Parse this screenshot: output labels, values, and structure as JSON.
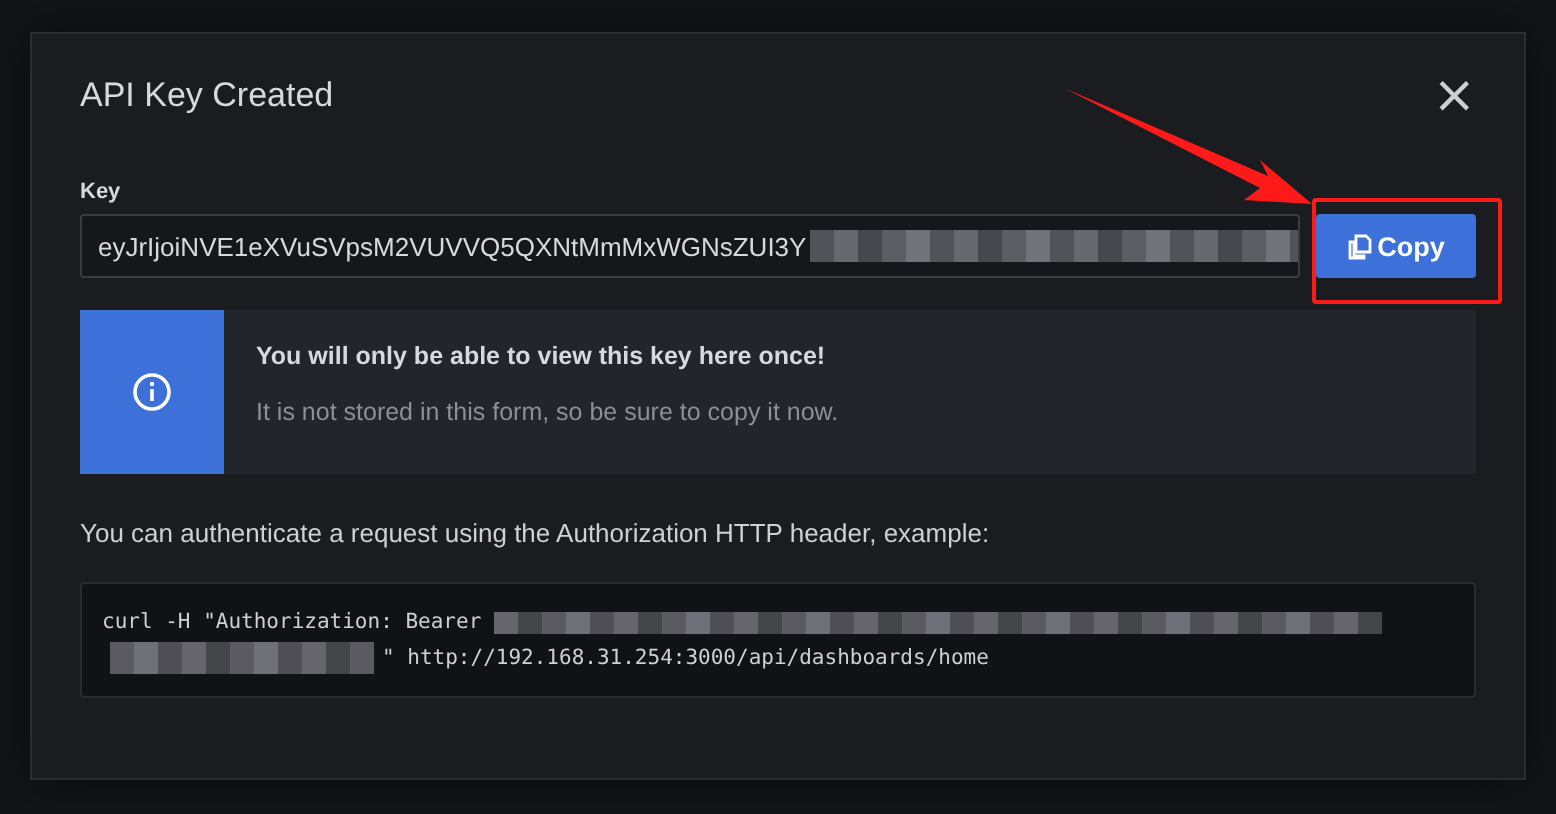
{
  "modal": {
    "title": "API Key Created",
    "close": "×",
    "key_field": {
      "label": "Key",
      "value": "eyJrIjoiNVE1eXVuSVpsM2VUVVQ5QXNtMmMxWGNsZUI3Y"
    },
    "copy_button": {
      "label": "Copy"
    },
    "alert": {
      "title": "You will only be able to view this key here once!",
      "text": "It is not stored in this form, so be sure to copy it now."
    },
    "hint": "You can authenticate a request using the Authorization HTTP header, example:",
    "code": {
      "line_1": "curl -H \"Authorization: Bearer ",
      "line_2": "\" http://192.168.31.254:3000/api/dashboards/home"
    }
  }
}
